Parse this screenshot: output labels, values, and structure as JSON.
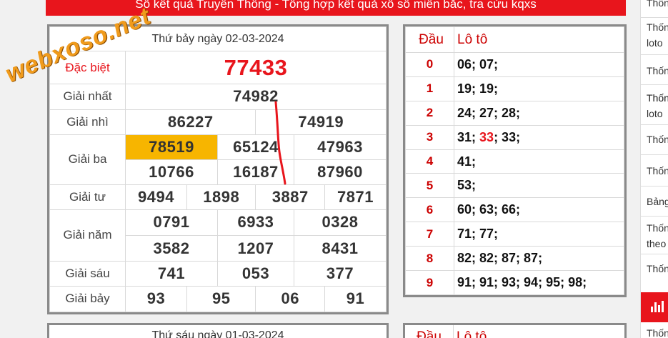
{
  "banner": {
    "text": "Sổ kết quả Truyền Thống - Tổng hợp kết quả xổ số miền bắc, tra cứu kqxs"
  },
  "watermark": "webxoso.net",
  "result": {
    "date_label": "Thứ bảy ngày 02-03-2024",
    "prizes": {
      "special": {
        "label": "Đặc biệt",
        "values": [
          "77433"
        ]
      },
      "first": {
        "label": "Giải nhất",
        "values": [
          "74982"
        ]
      },
      "second": {
        "label": "Giải nhì",
        "values": [
          "86227",
          "74919"
        ]
      },
      "third": {
        "label": "Giải ba",
        "values": [
          "78519",
          "65124",
          "47963",
          "10766",
          "16187",
          "87960"
        ]
      },
      "fourth": {
        "label": "Giải tư",
        "values": [
          "9494",
          "1898",
          "3887",
          "7871"
        ]
      },
      "fifth": {
        "label": "Giải năm",
        "values": [
          "0791",
          "6933",
          "0328",
          "3582",
          "1207",
          "8431"
        ]
      },
      "sixth": {
        "label": "Giải sáu",
        "values": [
          "741",
          "053",
          "377"
        ]
      },
      "seventh": {
        "label": "Giải bảy",
        "values": [
          "93",
          "95",
          "06",
          "91"
        ]
      }
    },
    "highlight_color": "#f7b500",
    "special_color": "#e8151c"
  },
  "loto": {
    "head_label": "Đầu",
    "loto_label": "Lô tô",
    "rows": [
      {
        "head": "0",
        "parts": [
          "06; 07;"
        ]
      },
      {
        "head": "1",
        "parts": [
          "19; 19;"
        ]
      },
      {
        "head": "2",
        "parts": [
          "24; 27; 28;"
        ]
      },
      {
        "head": "3",
        "parts": [
          "31; ",
          "33",
          "; 33;"
        ]
      },
      {
        "head": "4",
        "parts": [
          "41;"
        ]
      },
      {
        "head": "5",
        "parts": [
          "53;"
        ]
      },
      {
        "head": "6",
        "parts": [
          "60; 63; 66;"
        ]
      },
      {
        "head": "7",
        "parts": [
          "71; 77;"
        ]
      },
      {
        "head": "8",
        "parts": [
          "82; 82; 87; 87;"
        ]
      },
      {
        "head": "9",
        "parts": [
          "91; 91; 93; 94; 95; 98;"
        ]
      }
    ]
  },
  "next_result": {
    "date_label": "Thứ sáu ngày 01-03-2024",
    "head_label": "Đầu",
    "loto_label": "Lô tô"
  },
  "sidebar": {
    "items": [
      "Thốn",
      "Thốn",
      "loto",
      "Thốn",
      "Thốn",
      "loto",
      "Thốn",
      "Thốn",
      "Thốn",
      "Bảng",
      "Thốn",
      "theo",
      "Thốn",
      "Thốn"
    ],
    "stats_icon": "bar-chart-icon"
  }
}
